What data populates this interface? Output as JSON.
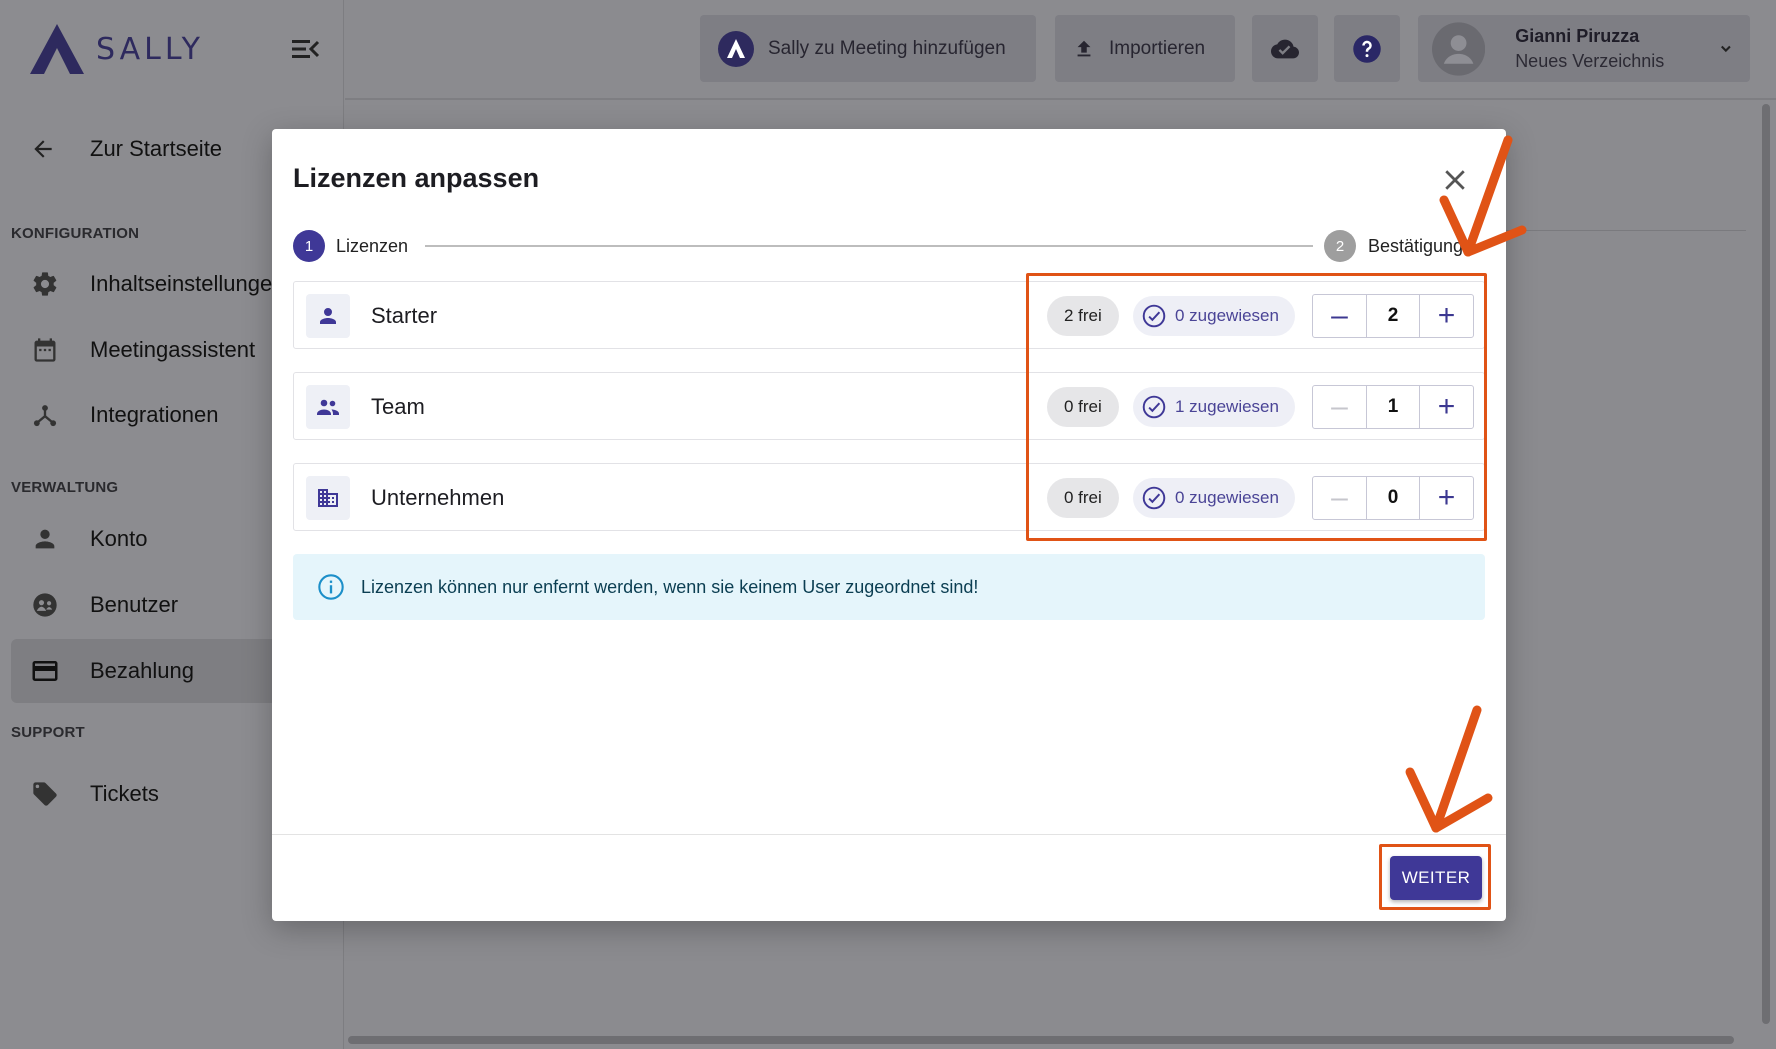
{
  "app": {
    "brand": "SALLY"
  },
  "sidebar": {
    "back_label": "Zur Startseite",
    "sections": {
      "config": "KONFIGURATION",
      "admin": "VERWALTUNG",
      "support": "SUPPORT"
    },
    "items": {
      "content": "Inhaltseinstellungen",
      "meeting": "Meetingassistent",
      "integrations": "Integrationen",
      "account": "Konto",
      "users": "Benutzer",
      "billing": "Bezahlung",
      "tickets": "Tickets"
    }
  },
  "topbar": {
    "add_meeting": "Sally zu Meeting hinzufügen",
    "import": "Importieren",
    "user_name": "Gianni Piruzza",
    "user_sub": "Neues Verzeichnis"
  },
  "modal": {
    "title": "Lizenzen anpassen",
    "steps": [
      {
        "num": "1",
        "label": "Lizenzen"
      },
      {
        "num": "2",
        "label": "Bestätigung"
      }
    ],
    "licenses": [
      {
        "name": "Starter",
        "free": "2 frei",
        "assigned": "0 zugewiesen",
        "qty": "2"
      },
      {
        "name": "Team",
        "free": "0 frei",
        "assigned": "1 zugewiesen",
        "qty": "1"
      },
      {
        "name": "Unternehmen",
        "free": "0 frei",
        "assigned": "0 zugewiesen",
        "qty": "0"
      }
    ],
    "info": "Lizenzen können nur enfernt werden, wenn sie keinem User zugeordnet sind!",
    "next_label": "WEITER"
  },
  "colors": {
    "primary": "#3f3897",
    "annotation": "#e05316",
    "info_bg": "#e5f5fb"
  }
}
